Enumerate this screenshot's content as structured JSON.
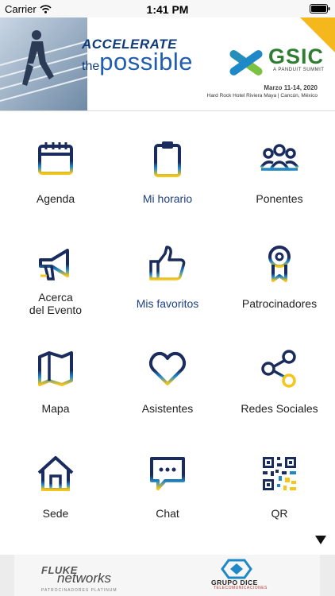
{
  "status_bar": {
    "carrier": "Carrier",
    "time": "1:41 PM"
  },
  "banner": {
    "headline_top": "ACCELERATE",
    "headline_the": "the",
    "headline_bottom": "possible",
    "event_logo": "GSIC",
    "event_sub": "A PANDUIT SUMMIT",
    "dates": "Marzo 11-14, 2020",
    "venue": "Hard Rock Hotel Riviera Maya | Cancún, México"
  },
  "menu": {
    "items": [
      {
        "label": "Agenda",
        "icon": "calendar-icon"
      },
      {
        "label": "Mi horario",
        "icon": "clipboard-icon"
      },
      {
        "label": "Ponentes",
        "icon": "people-icon"
      },
      {
        "label": "Acerca\ndel Evento",
        "icon": "megaphone-icon"
      },
      {
        "label": "Mis favoritos",
        "icon": "thumbs-up-icon"
      },
      {
        "label": "Patrocinadores",
        "icon": "award-ribbon-icon"
      },
      {
        "label": "Mapa",
        "icon": "map-icon"
      },
      {
        "label": "Asistentes",
        "icon": "heart-icon"
      },
      {
        "label": "Redes Sociales",
        "icon": "share-icon"
      },
      {
        "label": "Sede",
        "icon": "house-icon"
      },
      {
        "label": "Chat",
        "icon": "chat-bubble-icon"
      },
      {
        "label": "QR",
        "icon": "qr-code-icon"
      }
    ]
  },
  "sponsors": {
    "fluke_brand": "FLUKE",
    "fluke_networks": "networks",
    "tier": "PATROCINADORES PLATINUM",
    "dice_name": "GRUPO DICE",
    "dice_sub": "TELECOMUNICACIONES"
  },
  "colors": {
    "navy": "#1a2b5e",
    "blue": "#1f5eb0",
    "gold": "#f5c518",
    "green": "#2e7d32",
    "label_active": "#1e3f86"
  }
}
